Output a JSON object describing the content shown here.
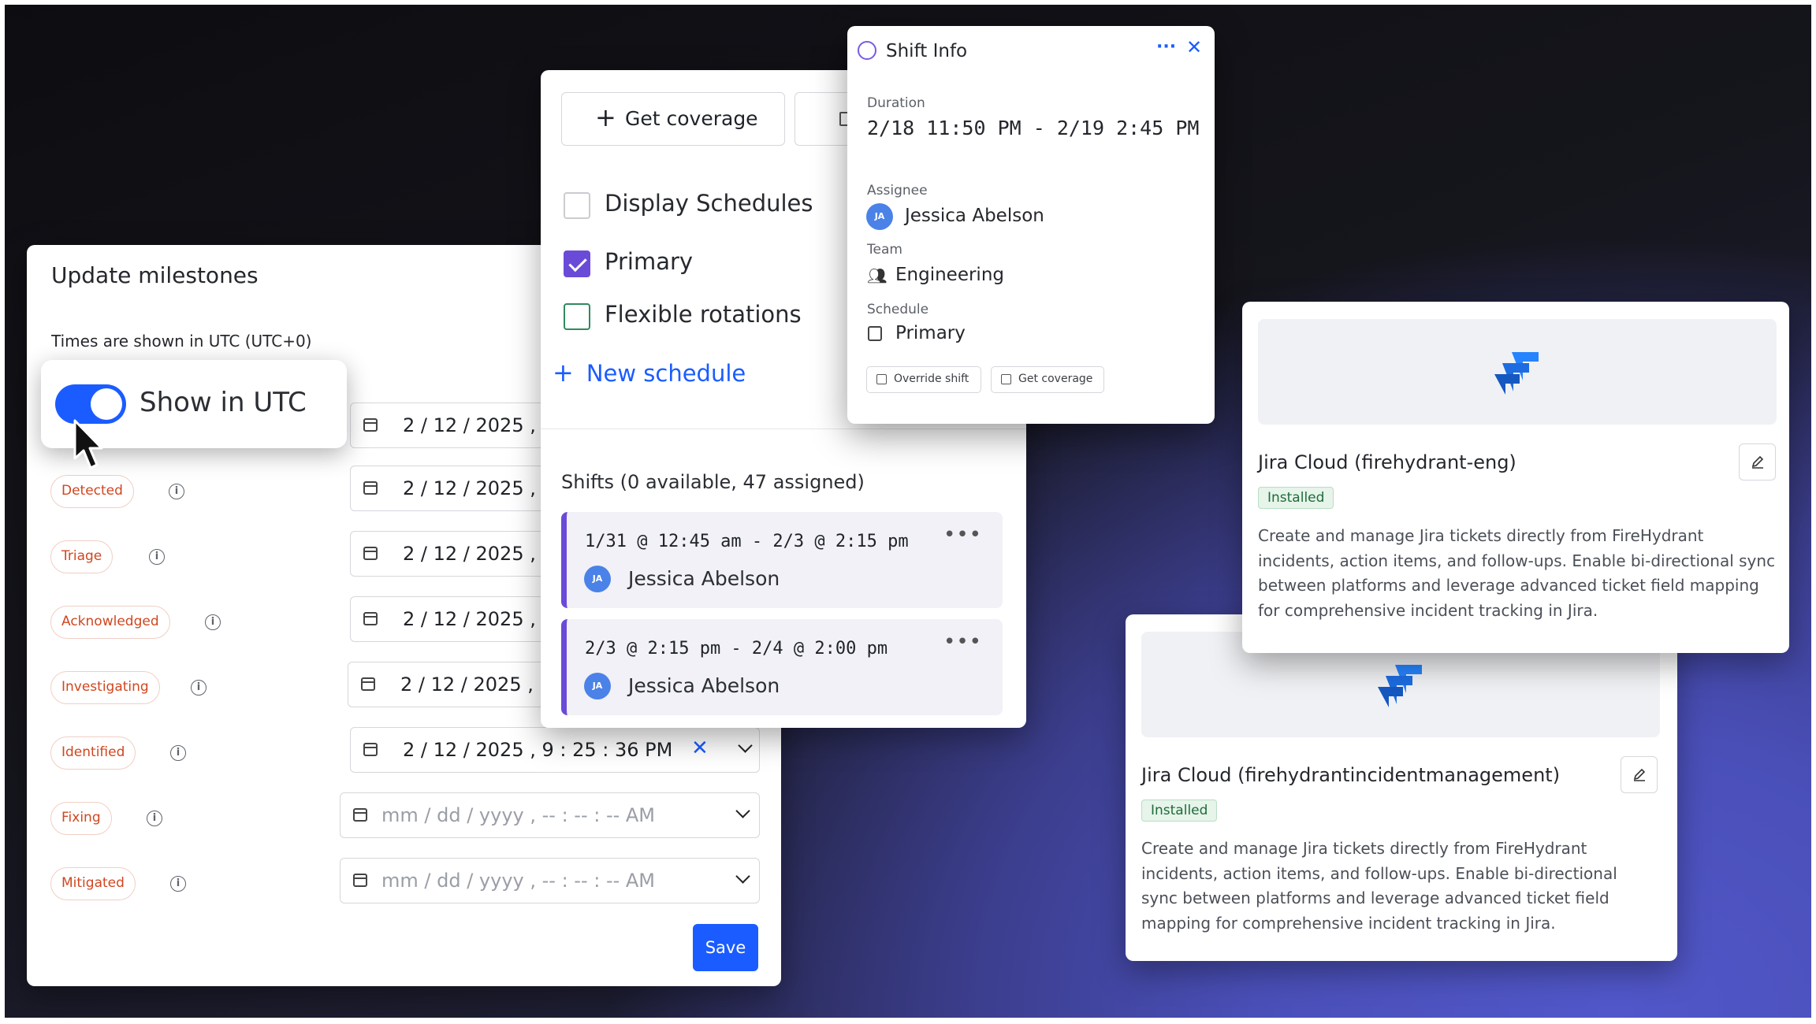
{
  "milestones": {
    "title": "Update milestones",
    "subtitle": "Times are shown in UTC (UTC+0)",
    "toggle_label": "Show in UTC",
    "save_label": "Save",
    "rows": [
      {
        "label": "",
        "month": "2",
        "day": "12",
        "year": "2025",
        "time": ""
      },
      {
        "label": "Detected",
        "month": "2",
        "day": "12",
        "year": "2025",
        "time": ""
      },
      {
        "label": "Triage",
        "month": "2",
        "day": "12",
        "year": "2025",
        "time": ""
      },
      {
        "label": "Acknowledged",
        "month": "2",
        "day": "12",
        "year": "2025",
        "time": ""
      },
      {
        "label": "Investigating",
        "month": "2",
        "day": "12",
        "year": "2025",
        "time": ""
      },
      {
        "label": "Identified",
        "month": "2",
        "day": "12",
        "year": "2025",
        "time": "9 : 25 : 36  PM"
      },
      {
        "label": "Fixing",
        "placeholder": "mm /  dd /   yyyy , -- : -- : --   AM"
      },
      {
        "label": "Mitigated",
        "placeholder": "mm /  dd /   yyyy , -- : -- : --   AM"
      }
    ]
  },
  "schedules": {
    "get_coverage": "Get coverage",
    "display_schedules": "Display Schedules",
    "primary": "Primary",
    "flexible": "Flexible rotations",
    "new_schedule": "New schedule",
    "shifts_title": "Shifts (0 available, 47 assigned)",
    "shifts": [
      {
        "time": "1/31 @ 12:45 am - 2/3 @ 2:15 pm",
        "initials": "JA",
        "name": "Jessica Abelson"
      },
      {
        "time": "2/3 @ 2:15 pm - 2/4 @ 2:00 pm",
        "initials": "JA",
        "name": "Jessica Abelson"
      }
    ]
  },
  "shift_info": {
    "title": "Shift Info",
    "duration_label": "Duration",
    "duration": "2/18 11:50 PM - 2/19 2:45 PM",
    "assignee_label": "Assignee",
    "assignee_initials": "JA",
    "assignee": "Jessica Abelson",
    "team_label": "Team",
    "team": "Engineering",
    "schedule_label": "Schedule",
    "schedule": "Primary",
    "override_btn": "Override shift",
    "coverage_btn": "Get coverage"
  },
  "integrations": [
    {
      "name": "Jira Cloud (firehydrant-eng)",
      "status": "Installed",
      "description": "Create and manage Jira tickets directly from FireHydrant incidents, action items, and follow-ups. Enable bi-directional sync between platforms and leverage advanced ticket field mapping for comprehensive incident tracking in Jira."
    },
    {
      "name": "Jira Cloud (firehydrantincidentmanagement)",
      "status": "Installed",
      "description": "Create and manage Jira tickets directly from FireHydrant incidents, action items, and follow-ups. Enable bi-directional sync between platforms and leverage advanced ticket field mapping for comprehensive incident tracking in Jira."
    }
  ],
  "colors": {
    "accent": "#1a5cff",
    "purple": "#6a4bd8",
    "chip": "#d0461f",
    "installed": "#1f6b3a"
  }
}
